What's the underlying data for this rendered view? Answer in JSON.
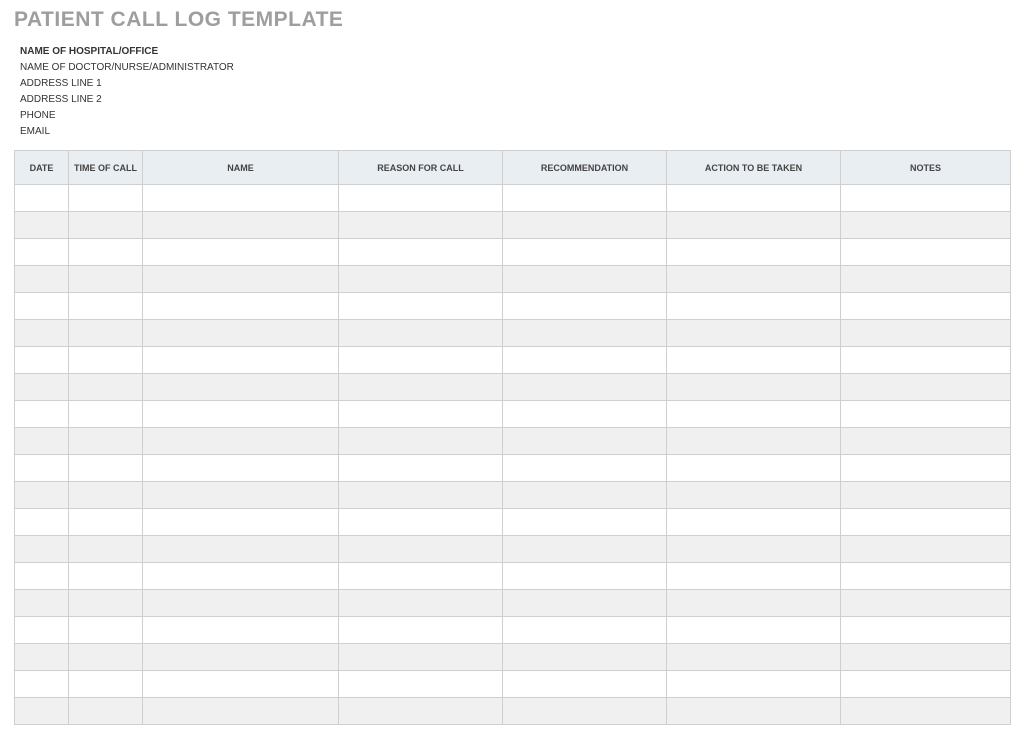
{
  "title": "PATIENT CALL LOG TEMPLATE",
  "meta": {
    "hospital": "NAME OF HOSPITAL/OFFICE",
    "doctor": "NAME OF DOCTOR/NURSE/ADMINISTRATOR",
    "address1": "ADDRESS LINE 1",
    "address2": "ADDRESS LINE 2",
    "phone": "PHONE",
    "email": "EMAIL"
  },
  "columns": {
    "date": "DATE",
    "time": "TIME OF CALL",
    "name": "NAME",
    "reason": "REASON FOR CALL",
    "recommendation": "RECOMMENDATION",
    "action": "ACTION TO BE TAKEN",
    "notes": "NOTES"
  },
  "rows": [
    {
      "date": "",
      "time": "",
      "name": "",
      "reason": "",
      "recommendation": "",
      "action": "",
      "notes": ""
    },
    {
      "date": "",
      "time": "",
      "name": "",
      "reason": "",
      "recommendation": "",
      "action": "",
      "notes": ""
    },
    {
      "date": "",
      "time": "",
      "name": "",
      "reason": "",
      "recommendation": "",
      "action": "",
      "notes": ""
    },
    {
      "date": "",
      "time": "",
      "name": "",
      "reason": "",
      "recommendation": "",
      "action": "",
      "notes": ""
    },
    {
      "date": "",
      "time": "",
      "name": "",
      "reason": "",
      "recommendation": "",
      "action": "",
      "notes": ""
    },
    {
      "date": "",
      "time": "",
      "name": "",
      "reason": "",
      "recommendation": "",
      "action": "",
      "notes": ""
    },
    {
      "date": "",
      "time": "",
      "name": "",
      "reason": "",
      "recommendation": "",
      "action": "",
      "notes": ""
    },
    {
      "date": "",
      "time": "",
      "name": "",
      "reason": "",
      "recommendation": "",
      "action": "",
      "notes": ""
    },
    {
      "date": "",
      "time": "",
      "name": "",
      "reason": "",
      "recommendation": "",
      "action": "",
      "notes": ""
    },
    {
      "date": "",
      "time": "",
      "name": "",
      "reason": "",
      "recommendation": "",
      "action": "",
      "notes": ""
    },
    {
      "date": "",
      "time": "",
      "name": "",
      "reason": "",
      "recommendation": "",
      "action": "",
      "notes": ""
    },
    {
      "date": "",
      "time": "",
      "name": "",
      "reason": "",
      "recommendation": "",
      "action": "",
      "notes": ""
    },
    {
      "date": "",
      "time": "",
      "name": "",
      "reason": "",
      "recommendation": "",
      "action": "",
      "notes": ""
    },
    {
      "date": "",
      "time": "",
      "name": "",
      "reason": "",
      "recommendation": "",
      "action": "",
      "notes": ""
    },
    {
      "date": "",
      "time": "",
      "name": "",
      "reason": "",
      "recommendation": "",
      "action": "",
      "notes": ""
    },
    {
      "date": "",
      "time": "",
      "name": "",
      "reason": "",
      "recommendation": "",
      "action": "",
      "notes": ""
    },
    {
      "date": "",
      "time": "",
      "name": "",
      "reason": "",
      "recommendation": "",
      "action": "",
      "notes": ""
    },
    {
      "date": "",
      "time": "",
      "name": "",
      "reason": "",
      "recommendation": "",
      "action": "",
      "notes": ""
    },
    {
      "date": "",
      "time": "",
      "name": "",
      "reason": "",
      "recommendation": "",
      "action": "",
      "notes": ""
    },
    {
      "date": "",
      "time": "",
      "name": "",
      "reason": "",
      "recommendation": "",
      "action": "",
      "notes": ""
    }
  ]
}
